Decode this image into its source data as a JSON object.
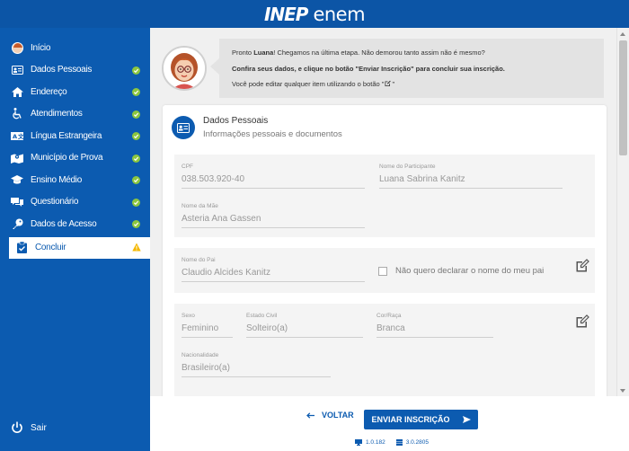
{
  "header": {
    "logo_inep": "INEP",
    "logo_enem": "enem"
  },
  "sidebar": {
    "items": [
      {
        "label": "Início",
        "icon": "avatar-icon",
        "status": "none"
      },
      {
        "label": "Dados Pessoais",
        "icon": "id-card-icon",
        "status": "complete"
      },
      {
        "label": "Endereço",
        "icon": "home-icon",
        "status": "complete"
      },
      {
        "label": "Atendimentos",
        "icon": "wheelchair-icon",
        "status": "complete"
      },
      {
        "label": "Língua Estrangeira",
        "icon": "language-icon",
        "status": "complete"
      },
      {
        "label": "Município de Prova",
        "icon": "map-icon",
        "status": "complete"
      },
      {
        "label": "Ensino Médio",
        "icon": "graduation-cap-icon",
        "status": "complete"
      },
      {
        "label": "Questionário",
        "icon": "chat-icon",
        "status": "complete"
      },
      {
        "label": "Dados de Acesso",
        "icon": "key-icon",
        "status": "complete"
      },
      {
        "label": "Concluir",
        "icon": "clipboard-check-icon",
        "status": "warning"
      }
    ],
    "logout_label": "Sair"
  },
  "speech": {
    "greeting_pre": "Pronto ",
    "name": "Luana",
    "greeting_post": "! Chegamos na última etapa. Não demorou tanto assim não é mesmo?",
    "instruction": "Confira seus dados, e clique no botão \"Enviar Inscrição\" para concluir sua inscrição.",
    "edit_hint": "Você pode editar qualquer item utilizando o botão"
  },
  "card": {
    "title": "Dados Pessoais",
    "subtitle": "Informações pessoais e documentos"
  },
  "fields": {
    "cpf": {
      "label": "CPF",
      "value": "038.503.920-40"
    },
    "nome": {
      "label": "Nome do Participante",
      "value": "Luana Sabrina Kanitz"
    },
    "mae": {
      "label": "Nome da Mãe",
      "value": "Asteria Ana Gassen"
    },
    "pai": {
      "label": "Nome do Pai",
      "value": "Claudio Alcides Kanitz"
    },
    "nao_declarar": {
      "label": "Não quero declarar o nome do meu pai",
      "checked": false
    },
    "sexo": {
      "label": "Sexo",
      "value": "Feminino"
    },
    "estado_civil": {
      "label": "Estado Civil",
      "value": "Solteiro(a)"
    },
    "cor_raca": {
      "label": "Cor/Raça",
      "value": "Branca"
    },
    "nacionalidade": {
      "label": "Nacionalidade",
      "value": "Brasileiro(a)"
    }
  },
  "footer": {
    "back_label": "VOLTAR",
    "submit_label": "ENVIAR INSCRIÇÃO",
    "version_front": "1.0.182",
    "version_back": "3.0.2805"
  },
  "colors": {
    "primary": "#0c5bb0",
    "header": "#0c55a6",
    "success": "#8cc63f",
    "warning": "#f5b800"
  }
}
